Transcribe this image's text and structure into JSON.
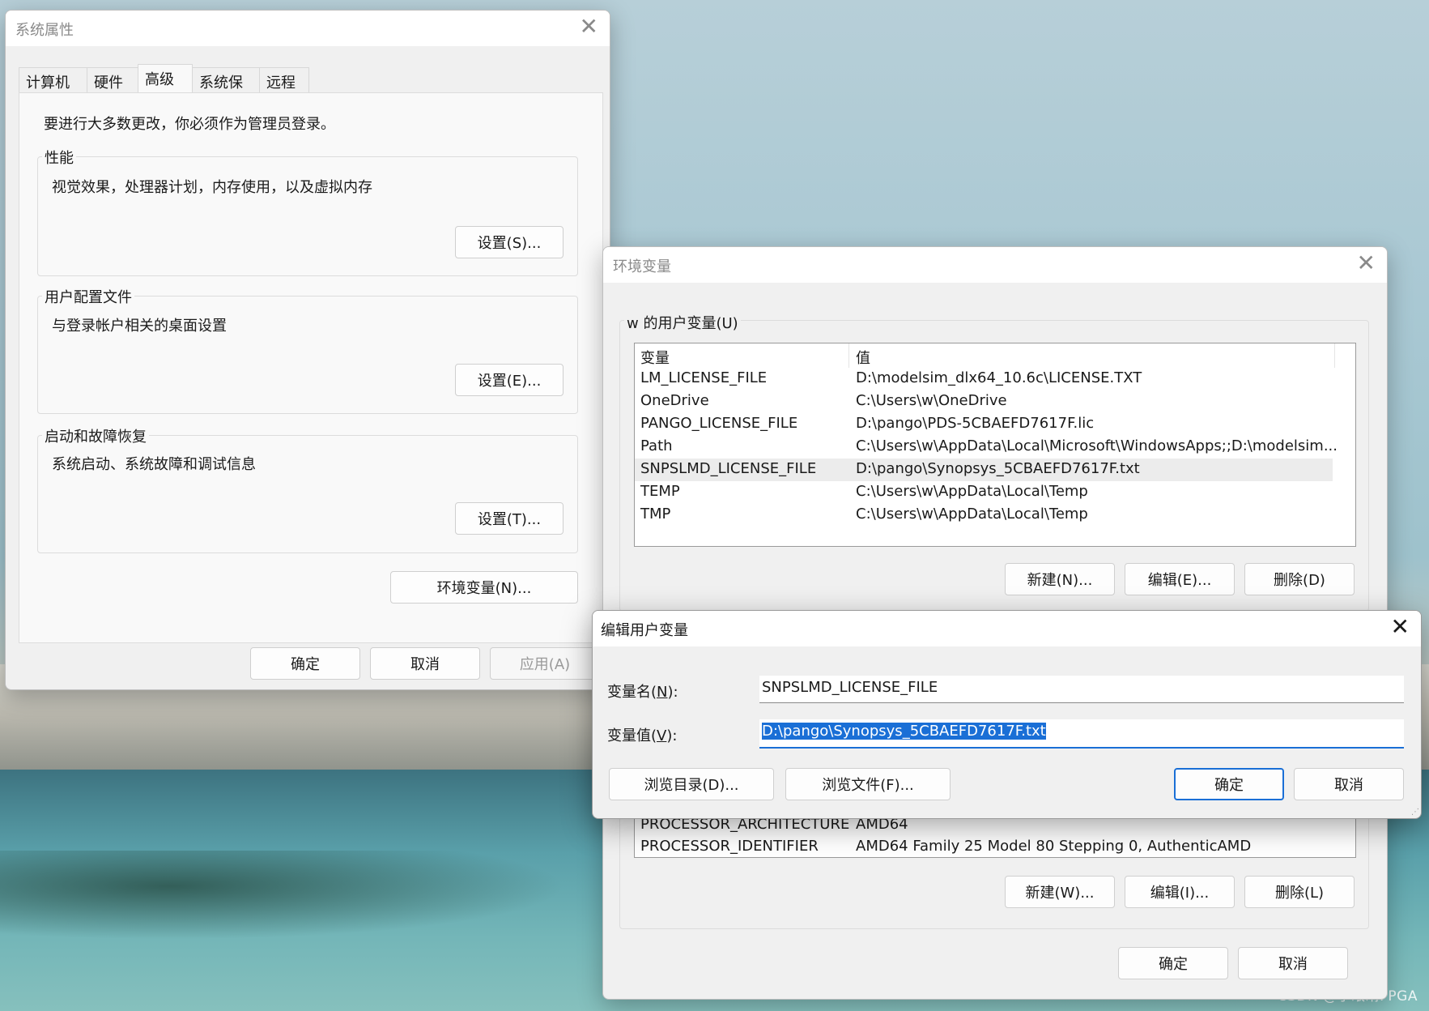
{
  "system_properties": {
    "title": "系统属性",
    "tabs": [
      "计算机名",
      "硬件",
      "高级",
      "系统保护",
      "远程"
    ],
    "active_tab": "高级",
    "admin_note": "要进行大多数更改，你必须作为管理员登录。",
    "performance": {
      "label": "性能",
      "description": "视觉效果，处理器计划，内存使用，以及虚拟内存",
      "button": "设置(S)..."
    },
    "user_profiles": {
      "label": "用户配置文件",
      "description": "与登录帐户相关的桌面设置",
      "button": "设置(E)..."
    },
    "startup_recovery": {
      "label": "启动和故障恢复",
      "description": "系统启动、系统故障和调试信息",
      "button": "设置(T)..."
    },
    "env_button": "环境变量(N)...",
    "ok": "确定",
    "cancel": "取消",
    "apply": "应用(A)"
  },
  "environment_variables": {
    "title": "环境变量",
    "user_group_label": "w 的用户变量(U)",
    "columns": [
      "变量",
      "值"
    ],
    "user_vars": [
      {
        "name": "LM_LICENSE_FILE",
        "value": "D:\\modelsim_dlx64_10.6c\\LICENSE.TXT"
      },
      {
        "name": "OneDrive",
        "value": "C:\\Users\\w\\OneDrive"
      },
      {
        "name": "PANGO_LICENSE_FILE",
        "value": "D:\\pango\\PDS-5CBAEFD7617F.lic"
      },
      {
        "name": "Path",
        "value": "C:\\Users\\w\\AppData\\Local\\Microsoft\\WindowsApps;;D:\\modelsim..."
      },
      {
        "name": "SNPSLMD_LICENSE_FILE",
        "value": "D:\\pango\\Synopsys_5CBAEFD7617F.txt"
      },
      {
        "name": "TEMP",
        "value": "C:\\Users\\w\\AppData\\Local\\Temp"
      },
      {
        "name": "TMP",
        "value": "C:\\Users\\w\\AppData\\Local\\Temp"
      }
    ],
    "selected_index": 4,
    "user_buttons": [
      "新建(N)...",
      "编辑(E)...",
      "删除(D)"
    ],
    "system_vars_visible": [
      {
        "name": "PROCESSOR_ARCHITECTURE",
        "value": "AMD64"
      },
      {
        "name": "PROCESSOR_IDENTIFIER",
        "value": "AMD64 Family 25 Model 80 Stepping 0, AuthenticAMD"
      }
    ],
    "system_buttons": [
      "新建(W)...",
      "编辑(I)...",
      "删除(L)"
    ],
    "ok": "确定",
    "cancel": "取消"
  },
  "edit_user_variable": {
    "title": "编辑用户变量",
    "name_label": "变量名(N):",
    "name_label_pre": "变量名(",
    "name_label_key": "N",
    "name_label_post": "):",
    "value_label_pre": "变量值(",
    "value_label_key": "V",
    "value_label_post": "):",
    "name_value": "SNPSLMD_LICENSE_FILE",
    "value_value": "D:\\pango\\Synopsys_5CBAEFD7617F.txt",
    "browse_dir": "浏览目录(D)...",
    "browse_file": "浏览文件(F)...",
    "ok": "确定",
    "cancel": "取消"
  },
  "watermark": "CSDN @小眼睛FPGA",
  "colors": {
    "accent": "#1a6fd6",
    "dialog_bg": "#f0f0f0"
  }
}
